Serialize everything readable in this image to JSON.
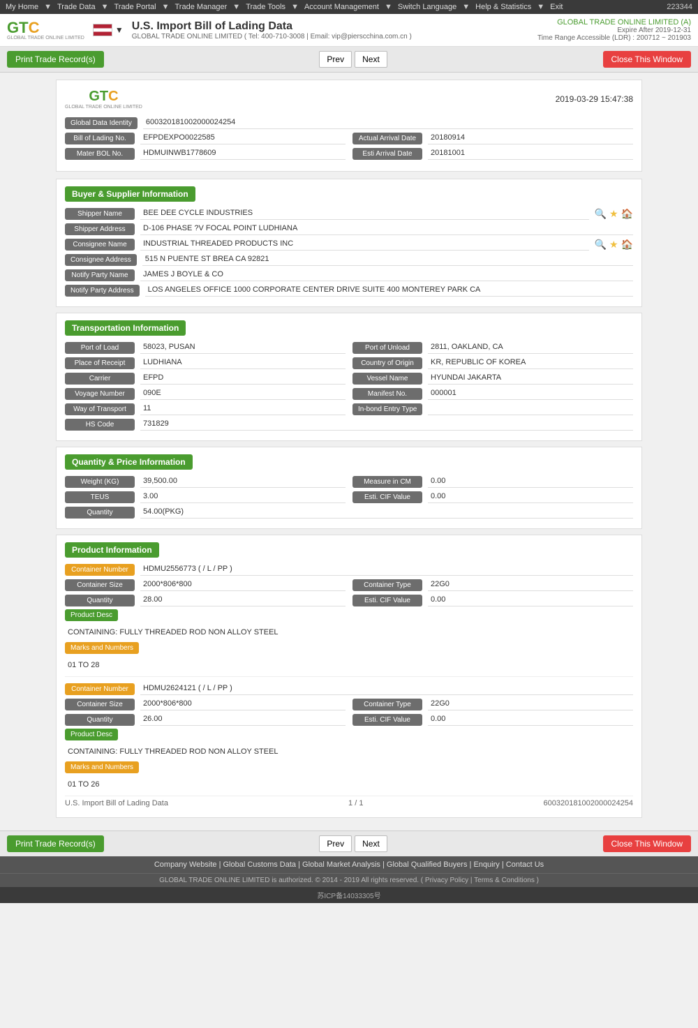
{
  "nav": {
    "items": [
      "My Home",
      "Trade Data",
      "Trade Portal",
      "Trade Manager",
      "Trade Tools",
      "Account Management",
      "Switch Language",
      "Help & Statistics",
      "Exit"
    ],
    "user_id": "223344"
  },
  "header": {
    "logo_text": "GTC",
    "logo_sub": "GLOBAL TRADE ONLINE LIMITED",
    "flag_alt": "US Flag",
    "title": "U.S. Import Bill of Lading Data",
    "subtitle": "GLOBAL TRADE ONLINE LIMITED ( Tel: 400-710-3008 | Email: vip@pierscchina.com.cn )",
    "company": "GLOBAL TRADE ONLINE LIMITED (A)",
    "expire": "Expire After 2019-12-31",
    "time_range": "Time Range Accessible (LDR) : 200712 ~ 201903"
  },
  "toolbar": {
    "print_label": "Print Trade Record(s)",
    "prev_label": "Prev",
    "next_label": "Next",
    "close_label": "Close This Window"
  },
  "record": {
    "timestamp": "2019-03-29 15:47:38",
    "global_data_identity_label": "Global Data Identity",
    "global_data_identity_value": "600320181002000024254",
    "bol_no_label": "Bill of Lading No.",
    "bol_no_value": "EFPDEXPO0022585",
    "actual_arrival_label": "Actual Arrival Date",
    "actual_arrival_value": "20180914",
    "master_bol_label": "Mater BOL No.",
    "master_bol_value": "HDMUINWB1778609",
    "esti_arrival_label": "Esti Arrival Date",
    "esti_arrival_value": "20181001"
  },
  "buyer_supplier": {
    "section_title": "Buyer & Supplier Information",
    "shipper_name_label": "Shipper Name",
    "shipper_name_value": "BEE DEE CYCLE INDUSTRIES",
    "shipper_address_label": "Shipper Address",
    "shipper_address_value": "D-106 PHASE ?V FOCAL POINT LUDHIANA",
    "consignee_name_label": "Consignee Name",
    "consignee_name_value": "INDUSTRIAL THREADED PRODUCTS INC",
    "consignee_address_label": "Consignee Address",
    "consignee_address_value": "515 N PUENTE ST BREA CA 92821",
    "notify_party_name_label": "Notify Party Name",
    "notify_party_name_value": "JAMES J BOYLE & CO",
    "notify_party_address_label": "Notify Party Address",
    "notify_party_address_value": "LOS ANGELES OFFICE 1000 CORPORATE CENTER DRIVE SUITE 400 MONTEREY PARK CA"
  },
  "transportation": {
    "section_title": "Transportation Information",
    "port_of_load_label": "Port of Load",
    "port_of_load_value": "58023, PUSAN",
    "port_of_unload_label": "Port of Unload",
    "port_of_unload_value": "2811, OAKLAND, CA",
    "place_of_receipt_label": "Place of Receipt",
    "place_of_receipt_value": "LUDHIANA",
    "country_of_origin_label": "Country of Origin",
    "country_of_origin_value": "KR, REPUBLIC OF KOREA",
    "carrier_label": "Carrier",
    "carrier_value": "EFPD",
    "vessel_name_label": "Vessel Name",
    "vessel_name_value": "HYUNDAI JAKARTA",
    "voyage_number_label": "Voyage Number",
    "voyage_number_value": "090E",
    "manifest_no_label": "Manifest No.",
    "manifest_no_value": "000001",
    "way_of_transport_label": "Way of Transport",
    "way_of_transport_value": "11",
    "in_bond_entry_label": "In-bond Entry Type",
    "in_bond_entry_value": "",
    "hs_code_label": "HS Code",
    "hs_code_value": "731829"
  },
  "quantity_price": {
    "section_title": "Quantity & Price Information",
    "weight_kg_label": "Weight (KG)",
    "weight_kg_value": "39,500.00",
    "measure_cm_label": "Measure in CM",
    "measure_cm_value": "0.00",
    "teus_label": "TEUS",
    "teus_value": "3.00",
    "esti_cif_label": "Esti. CIF Value",
    "esti_cif_value": "0.00",
    "quantity_label": "Quantity",
    "quantity_value": "54.00(PKG)"
  },
  "products": [
    {
      "container_number_label": "Container Number",
      "container_number_value": "HDMU2556773 ( / L / PP )",
      "container_size_label": "Container Size",
      "container_size_value": "2000*806*800",
      "container_type_label": "Container Type",
      "container_type_value": "22G0",
      "quantity_label": "Quantity",
      "quantity_value": "28.00",
      "esti_cif_label": "Esti. CIF Value",
      "esti_cif_value": "0.00",
      "product_desc_label": "Product Desc",
      "product_desc_value": "CONTAINING: FULLY THREADED ROD NON ALLOY STEEL",
      "marks_label": "Marks and Numbers",
      "marks_value": "01 TO 28"
    },
    {
      "container_number_label": "Container Number",
      "container_number_value": "HDMU2624121 ( / L / PP )",
      "container_size_label": "Container Size",
      "container_size_value": "2000*806*800",
      "container_type_label": "Container Type",
      "container_type_value": "22G0",
      "quantity_label": "Quantity",
      "quantity_value": "26.00",
      "esti_cif_label": "Esti. CIF Value",
      "esti_cif_value": "0.00",
      "product_desc_label": "Product Desc",
      "product_desc_value": "CONTAINING: FULLY THREADED ROD NON ALLOY STEEL",
      "marks_label": "Marks and Numbers",
      "marks_value": "01 TO 26"
    }
  ],
  "record_footer": {
    "left": "U.S. Import Bill of Lading Data",
    "center": "1 / 1",
    "right": "600320181002000024254"
  },
  "footer": {
    "links": [
      "Company Website",
      "Global Customs Data",
      "Global Market Analysis",
      "Global Qualified Buyers",
      "Enquiry",
      "Contact Us"
    ],
    "copyright": "GLOBAL TRADE ONLINE LIMITED is authorized. © 2014 - 2019 All rights reserved. ( Privacy Policy | Terms & Conditions )",
    "icp": "苏ICP备14033305号"
  }
}
